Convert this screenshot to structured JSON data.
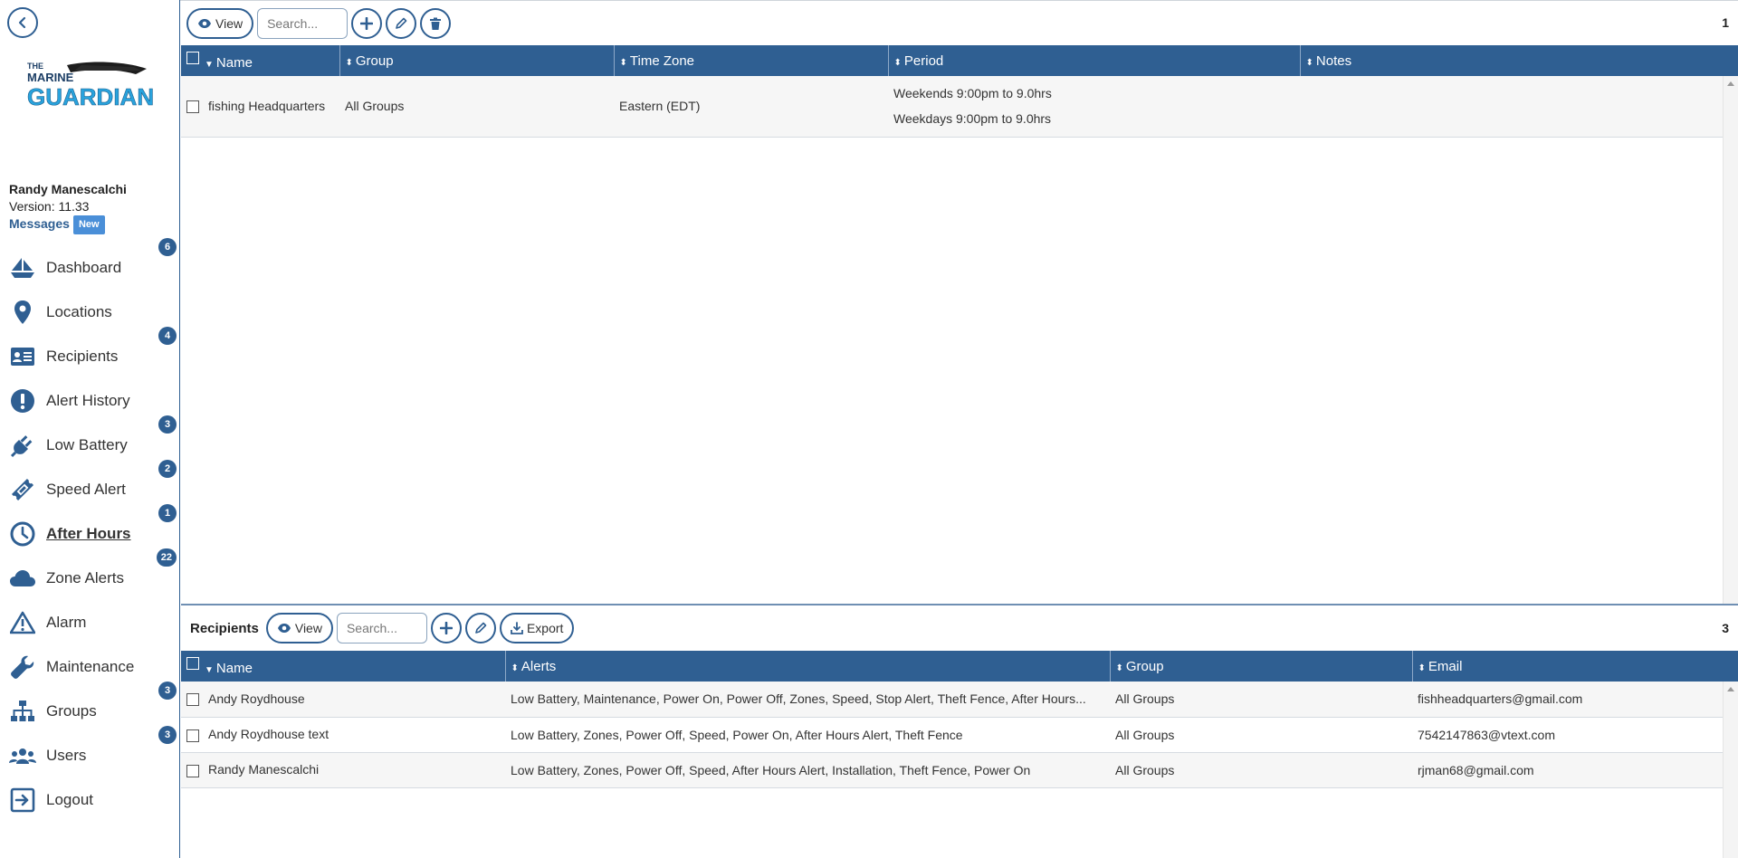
{
  "sidebar": {
    "logo": {
      "line1": "THE",
      "line2": "MARINE",
      "line3": "GUARDIAN"
    },
    "user": {
      "name": "Randy Manescalchi",
      "version": "Version: 11.33",
      "messages": "Messages",
      "new_badge": "New"
    },
    "items": [
      {
        "label": "Dashboard",
        "icon": "sailboat-icon",
        "badge": "6"
      },
      {
        "label": "Locations",
        "icon": "map-pin-icon",
        "badge": ""
      },
      {
        "label": "Recipients",
        "icon": "id-card-icon",
        "badge": "4"
      },
      {
        "label": "Alert History",
        "icon": "exclamation-icon",
        "badge": ""
      },
      {
        "label": "Low Battery",
        "icon": "plug-icon",
        "badge": "3"
      },
      {
        "label": "Speed Alert",
        "icon": "ticket-icon",
        "badge": "2"
      },
      {
        "label": "After Hours",
        "icon": "clock-icon",
        "badge": "1",
        "active": true
      },
      {
        "label": "Zone Alerts",
        "icon": "cloud-icon",
        "badge": "22"
      },
      {
        "label": "Alarm",
        "icon": "warning-icon",
        "badge": ""
      },
      {
        "label": "Maintenance",
        "icon": "wrench-icon",
        "badge": ""
      },
      {
        "label": "Groups",
        "icon": "sitemap-icon",
        "badge": "3"
      },
      {
        "label": "Users",
        "icon": "users-icon",
        "badge": "3"
      },
      {
        "label": "Logout",
        "icon": "logout-icon",
        "badge": ""
      }
    ]
  },
  "after_hours": {
    "view_label": "View",
    "search_placeholder": "Search...",
    "count": "1",
    "columns": [
      "Name",
      "Group",
      "Time Zone",
      "Period",
      "Notes"
    ],
    "rows": [
      {
        "name": "fishing Headquarters",
        "group": "All Groups",
        "timezone": "Eastern (EDT)",
        "period": [
          "Weekends 9:00pm to 9.0hrs",
          "Weekdays 9:00pm to 9.0hrs"
        ],
        "notes": ""
      }
    ]
  },
  "recipients": {
    "title": "Recipients",
    "view_label": "View",
    "search_placeholder": "Search...",
    "export_label": "Export",
    "count": "3",
    "columns": [
      "Name",
      "Alerts",
      "Group",
      "Email"
    ],
    "rows": [
      {
        "name": "Andy Roydhouse",
        "alerts": "Low Battery, Maintenance, Power On, Power Off, Zones, Speed, Stop Alert, Theft Fence, After Hours...",
        "group": "All Groups",
        "email": "fishheadquarters@gmail.com"
      },
      {
        "name": "Andy Roydhouse text",
        "alerts": "Low Battery, Zones, Power Off, Speed, Power On, After Hours Alert, Theft Fence",
        "group": "All Groups",
        "email": "7542147863@vtext.com"
      },
      {
        "name": "Randy Manescalchi",
        "alerts": "Low Battery, Zones, Power Off, Speed, After Hours Alert, Installation, Theft Fence, Power On",
        "group": "All Groups",
        "email": "rjman68@gmail.com"
      }
    ]
  },
  "colors": {
    "accent": "#2f5f92",
    "new_badge": "#4a8fd8",
    "logo_blue": "#29a3dd"
  }
}
